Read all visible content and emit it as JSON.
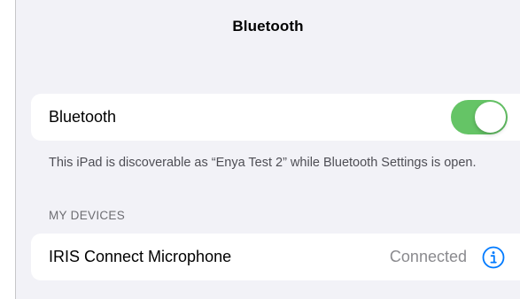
{
  "nav": {
    "title": "Bluetooth"
  },
  "bluetooth": {
    "label": "Bluetooth",
    "enabled": true,
    "toggle_color": "#65c466",
    "footer": "This iPad is discoverable as “Enya Test 2” while Bluetooth Settings is open."
  },
  "my_devices": {
    "header": "MY DEVICES",
    "items": [
      {
        "name": "IRIS Connect Microphone",
        "status": "Connected",
        "icon": "info-icon",
        "accent": "#007aff"
      }
    ]
  }
}
